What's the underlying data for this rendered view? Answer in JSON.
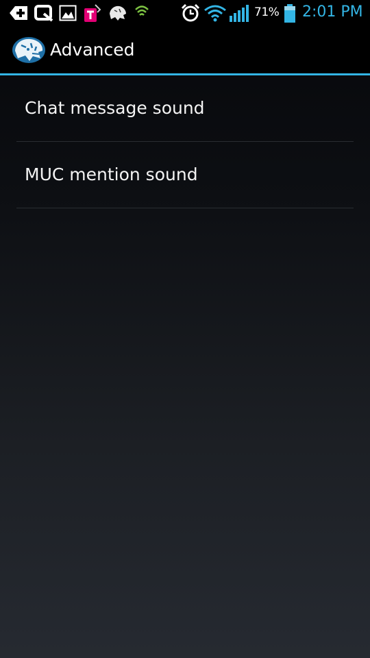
{
  "status_bar": {
    "battery_percent": "71%",
    "time": "2:01 PM",
    "icons": [
      "add-box-icon",
      "q-app-icon",
      "gallery-icon",
      "t-mobile-icon",
      "tiger-notification-icon",
      "tiger-notification-icon",
      "shield-icon",
      "alarm-icon",
      "wifi-icon",
      "signal-icon",
      "battery-icon"
    ]
  },
  "action_bar": {
    "title": "Advanced",
    "logo_icon": "tiger-logo-icon",
    "accent_color": "#33b5e5"
  },
  "preferences": [
    {
      "label": "Chat message sound"
    },
    {
      "label": "MUC mention sound"
    }
  ]
}
